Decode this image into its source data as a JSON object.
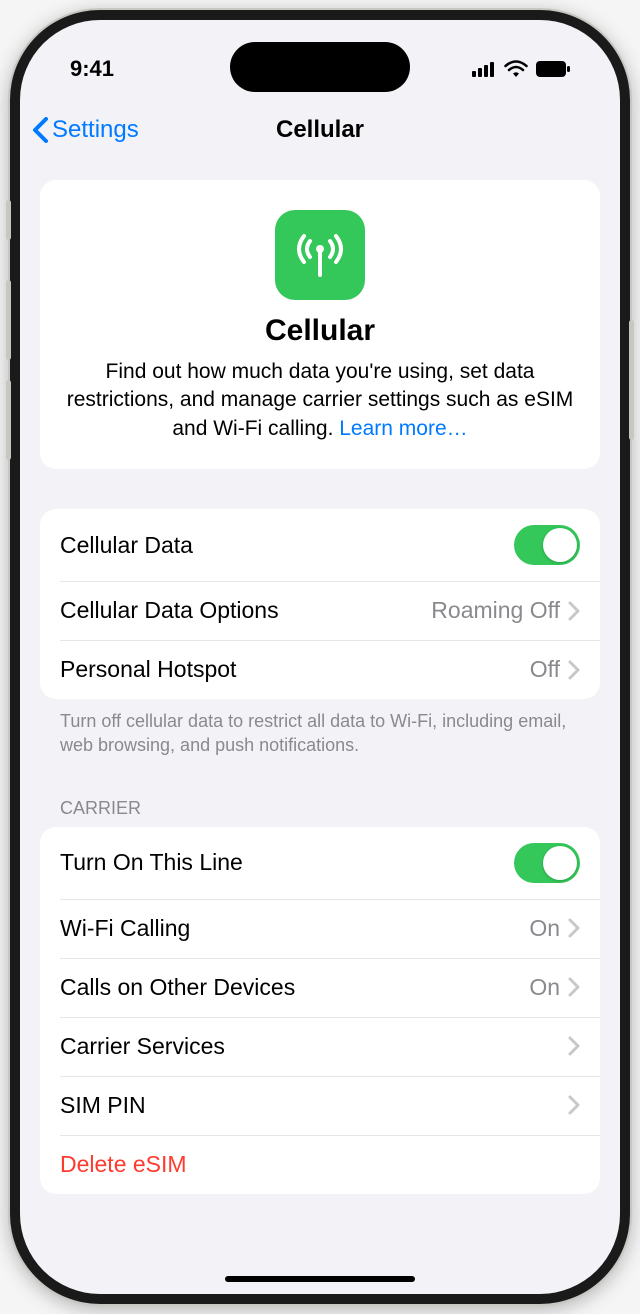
{
  "status": {
    "time": "9:41"
  },
  "nav": {
    "back": "Settings",
    "title": "Cellular"
  },
  "hero": {
    "title": "Cellular",
    "desc": "Find out how much data you're using, set data restrictions, and manage carrier settings such as eSIM and Wi-Fi calling. ",
    "link": "Learn more…"
  },
  "group1": {
    "rows": [
      {
        "label": "Cellular Data"
      },
      {
        "label": "Cellular Data Options",
        "value": "Roaming Off"
      },
      {
        "label": "Personal Hotspot",
        "value": "Off"
      }
    ],
    "footer": "Turn off cellular data to restrict all data to Wi-Fi, including email, web browsing, and push notifications."
  },
  "group2": {
    "header": "CARRIER",
    "rows": [
      {
        "label": "Turn On This Line"
      },
      {
        "label": "Wi-Fi Calling",
        "value": "On"
      },
      {
        "label": "Calls on Other Devices",
        "value": "On"
      },
      {
        "label": "Carrier Services"
      },
      {
        "label": "SIM PIN"
      },
      {
        "label": "Delete eSIM"
      }
    ]
  }
}
